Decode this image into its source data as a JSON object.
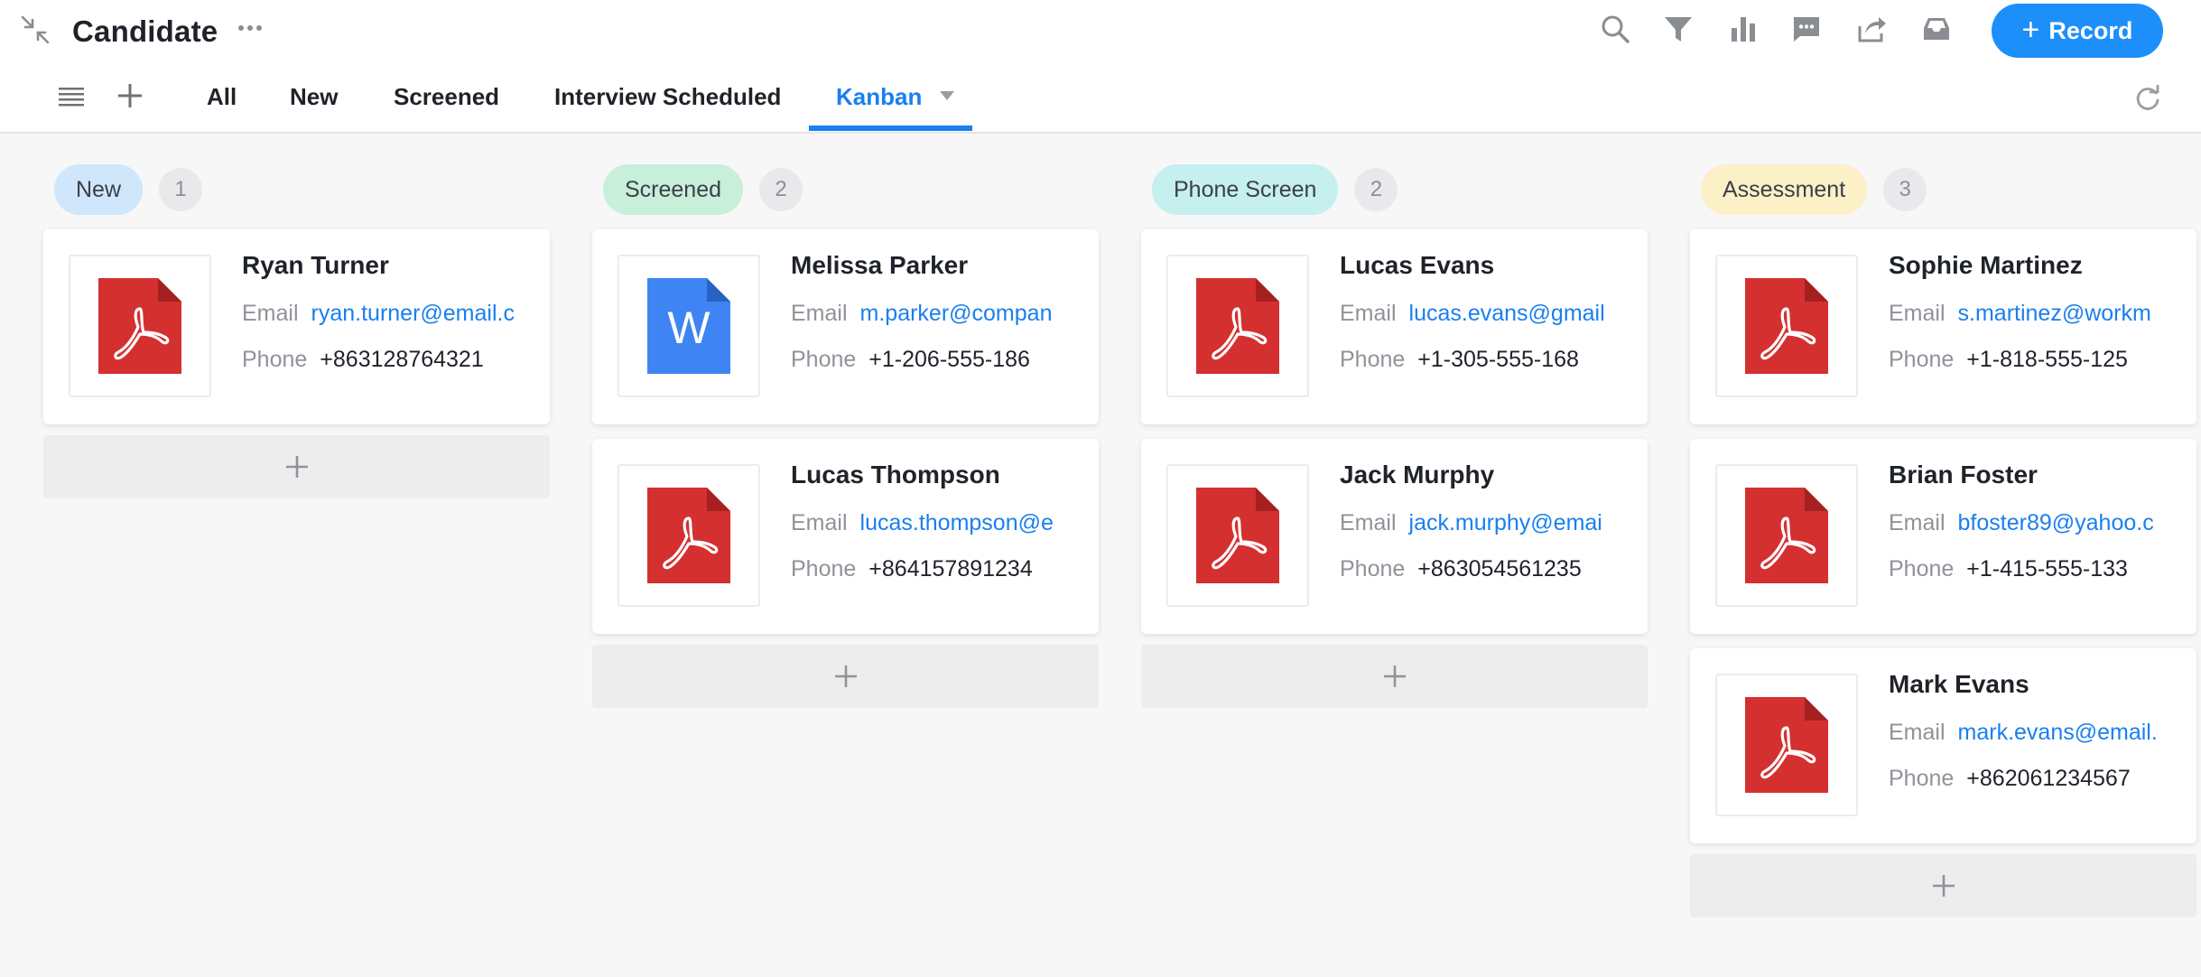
{
  "header": {
    "title": "Candidate",
    "record_button": "Record",
    "tabs": [
      {
        "label": "All"
      },
      {
        "label": "New"
      },
      {
        "label": "Screened"
      },
      {
        "label": "Interview Scheduled"
      },
      {
        "label": "Kanban",
        "active": true
      }
    ],
    "tool_icons": [
      "search-icon",
      "filter-icon",
      "chart-icon",
      "comment-icon",
      "share-icon",
      "inbox-icon"
    ]
  },
  "colors": {
    "accent": "#1d8ffb",
    "pdf_red": "#d43030",
    "word_blue": "#3e85f3"
  },
  "board": {
    "field_labels": {
      "email": "Email",
      "phone": "Phone"
    },
    "columns": [
      {
        "status": "New",
        "count": "1",
        "pill_color": "#cfe6fb",
        "cards": [
          {
            "name": "Ryan Turner",
            "email": "ryan.turner@email.c",
            "phone": "+863128764321",
            "file": "pdf"
          }
        ]
      },
      {
        "status": "Screened",
        "count": "2",
        "pill_color": "#c8efd9",
        "cards": [
          {
            "name": "Melissa Parker",
            "email": "m.parker@compan",
            "phone": "+1-206-555-186",
            "file": "word"
          },
          {
            "name": "Lucas Thompson",
            "email": "lucas.thompson@e",
            "phone": "+864157891234",
            "file": "pdf"
          }
        ]
      },
      {
        "status": "Phone Screen",
        "count": "2",
        "pill_color": "#c6eff0",
        "cards": [
          {
            "name": "Lucas Evans",
            "email": "lucas.evans@gmail",
            "phone": "+1-305-555-168",
            "file": "pdf"
          },
          {
            "name": "Jack Murphy",
            "email": "jack.murphy@emai",
            "phone": "+863054561235",
            "file": "pdf"
          }
        ]
      },
      {
        "status": "Assessment",
        "count": "3",
        "pill_color": "#fcf0c6",
        "cards": [
          {
            "name": "Sophie Martinez",
            "email": "s.martinez@workm",
            "phone": "+1-818-555-125",
            "file": "pdf"
          },
          {
            "name": "Brian Foster",
            "email": "bfoster89@yahoo.c",
            "phone": "+1-415-555-133",
            "file": "pdf"
          },
          {
            "name": "Mark Evans",
            "email": "mark.evans@email.",
            "phone": "+862061234567",
            "file": "pdf"
          }
        ]
      }
    ]
  }
}
